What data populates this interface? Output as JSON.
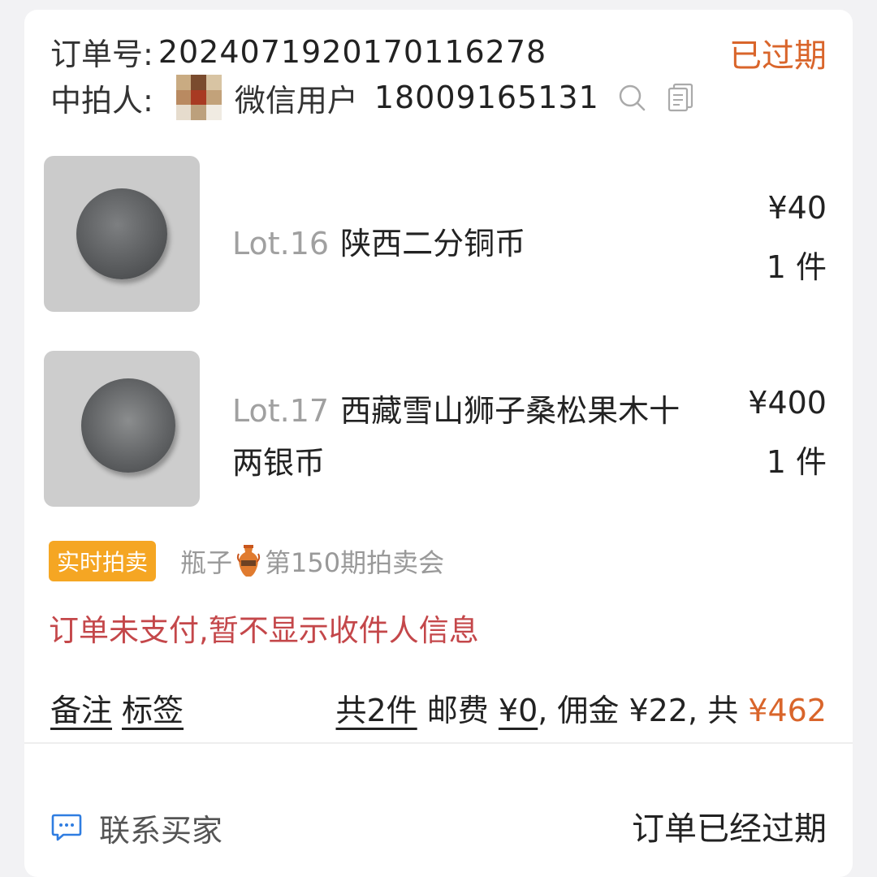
{
  "order": {
    "number_label": "订单号:",
    "number": "2024071920170116278",
    "status": "已过期"
  },
  "buyer": {
    "label": "中拍人:",
    "nickname": "微信用户",
    "phone": "18009165131",
    "search_icon": "search-icon",
    "copy_icon": "copy-icon"
  },
  "items": [
    {
      "lot": "Lot.16",
      "title": "陕西二分铜币",
      "price": "¥40",
      "qty": "1 件"
    },
    {
      "lot": "Lot.17",
      "title_line1": "西藏雪山狮子桑松果木十",
      "title_line2": "两银币",
      "price": "¥400",
      "qty": "1 件"
    }
  ],
  "auction": {
    "badge": "实时拍卖",
    "session_prefix": "瓶子",
    "session_icon": "vase-icon",
    "session_suffix": "第150期拍卖会"
  },
  "warning": "订单未支付,暂不显示收件人信息",
  "actions": {
    "remark": "备注",
    "tags": "标签"
  },
  "summary": {
    "count": "共2件",
    "shipping_label": "邮费",
    "shipping": "¥0",
    "commission": ", 佣金 ¥22, 共",
    "total": "¥462"
  },
  "footer": {
    "contact": "联系买家",
    "contact_icon": "chat-icon",
    "status": "订单已经过期"
  },
  "colors": {
    "accent": "#d9652b",
    "warning": "#c4474a",
    "badge": "#f5a623"
  }
}
